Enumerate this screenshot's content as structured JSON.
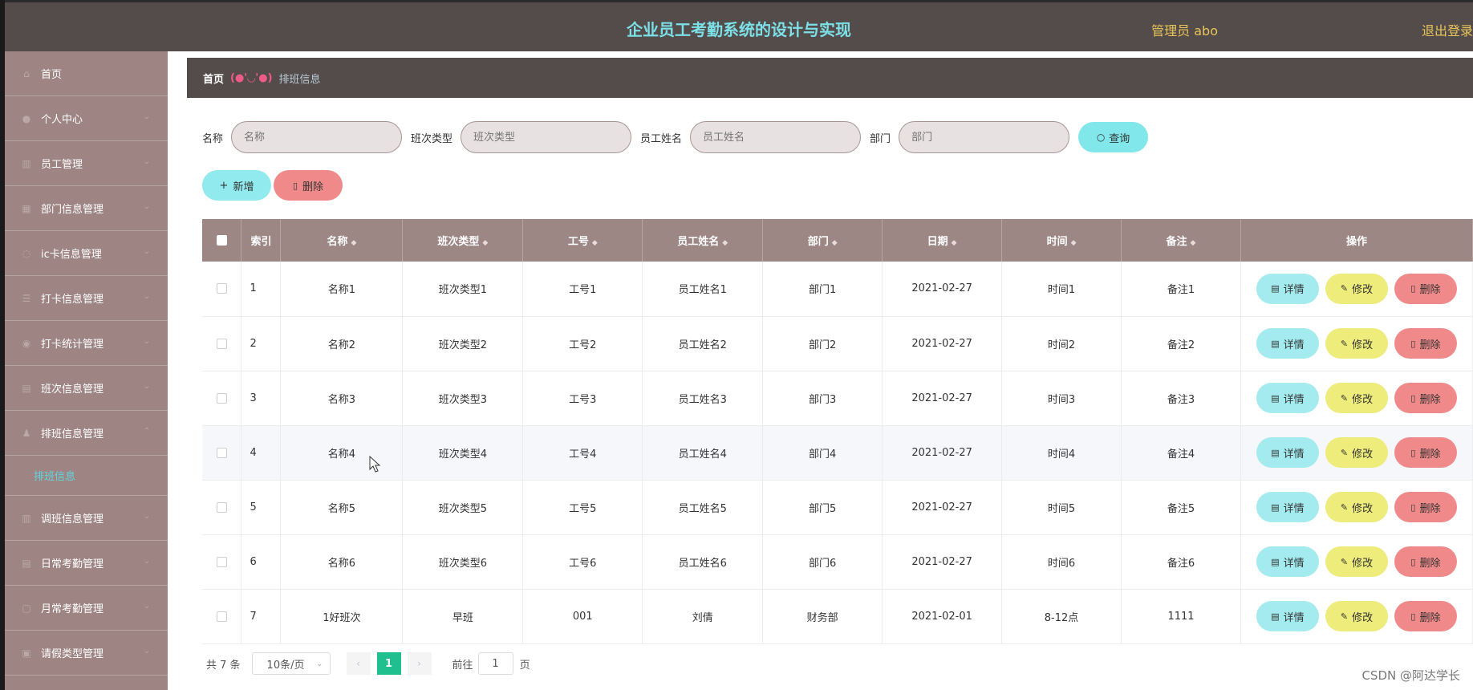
{
  "header": {
    "title": "企业员工考勤系统的设计与实现",
    "admin": "管理员 abo",
    "logout": "退出登录"
  },
  "sidebar": {
    "items": [
      {
        "label": "首页",
        "icon": "home-icon",
        "expandable": false
      },
      {
        "label": "个人中心",
        "icon": "user-icon",
        "expandable": true
      },
      {
        "label": "员工管理",
        "icon": "chart-icon",
        "expandable": true
      },
      {
        "label": "部门信息管理",
        "icon": "folder-icon",
        "expandable": true
      },
      {
        "label": "ic卡信息管理",
        "icon": "card-icon",
        "expandable": true
      },
      {
        "label": "打卡信息管理",
        "icon": "list-icon",
        "expandable": true
      },
      {
        "label": "打卡统计管理",
        "icon": "stats-icon",
        "expandable": true
      },
      {
        "label": "班次信息管理",
        "icon": "calendar-icon",
        "expandable": true
      },
      {
        "label": "排班信息管理",
        "icon": "schedule-icon",
        "expandable": true,
        "expanded": true
      }
    ],
    "sub_item": "排班信息",
    "items_after": [
      {
        "label": "调班信息管理",
        "icon": "swap-icon"
      },
      {
        "label": "日常考勤管理",
        "icon": "calendar-icon"
      },
      {
        "label": "月常考勤管理",
        "icon": "calendar-icon"
      },
      {
        "label": "请假类型管理",
        "icon": "leave-icon"
      }
    ]
  },
  "breadcrumb": {
    "home": "首页",
    "sep": "(●'◡'●)",
    "current": "排班信息"
  },
  "search": {
    "name_label": "名称",
    "name_placeholder": "名称",
    "type_label": "班次类型",
    "type_placeholder": "班次类型",
    "employee_label": "员工姓名",
    "employee_placeholder": "员工姓名",
    "dept_label": "部门",
    "dept_placeholder": "部门",
    "query_button": "查询"
  },
  "actions": {
    "add": "新增",
    "delete": "删除"
  },
  "table": {
    "headers": [
      "索引",
      "名称",
      "班次类型",
      "工号",
      "员工姓名",
      "部门",
      "日期",
      "时间",
      "备注",
      "操作"
    ],
    "rows": [
      [
        "1",
        "名称1",
        "班次类型1",
        "工号1",
        "员工姓名1",
        "部门1",
        "2021-02-27",
        "时间1",
        "备注1"
      ],
      [
        "2",
        "名称2",
        "班次类型2",
        "工号2",
        "员工姓名2",
        "部门2",
        "2021-02-27",
        "时间2",
        "备注2"
      ],
      [
        "3",
        "名称3",
        "班次类型3",
        "工号3",
        "员工姓名3",
        "部门3",
        "2021-02-27",
        "时间3",
        "备注3"
      ],
      [
        "4",
        "名称4",
        "班次类型4",
        "工号4",
        "员工姓名4",
        "部门4",
        "2021-02-27",
        "时间4",
        "备注4"
      ],
      [
        "5",
        "名称5",
        "班次类型5",
        "工号5",
        "员工姓名5",
        "部门5",
        "2021-02-27",
        "时间5",
        "备注5"
      ],
      [
        "6",
        "名称6",
        "班次类型6",
        "工号6",
        "员工姓名6",
        "部门6",
        "2021-02-27",
        "时间6",
        "备注6"
      ],
      [
        "7",
        "1好班次",
        "早班",
        "001",
        "刘倩",
        "财务部",
        "2021-02-01",
        "8-12点",
        "1111"
      ]
    ],
    "row_actions": {
      "detail": "详情",
      "edit": "修改",
      "delete": "删除"
    }
  },
  "pagination": {
    "total": "共 7 条",
    "page_size": "10条/页",
    "current_page": "1",
    "goto_label": "前往",
    "goto_value": "1",
    "page_unit": "页"
  },
  "watermark": "CSDN @阿达学长",
  "colors": {
    "header_bg": "#534c4b",
    "sidebar_bg": "#9e8583",
    "title": "#7ce0e6",
    "admin": "#e8c55a",
    "detail_btn": "#a3ebee",
    "edit_btn": "#eeec7b",
    "delete_btn": "#f08a8a",
    "page_active": "#1fbf8f"
  }
}
